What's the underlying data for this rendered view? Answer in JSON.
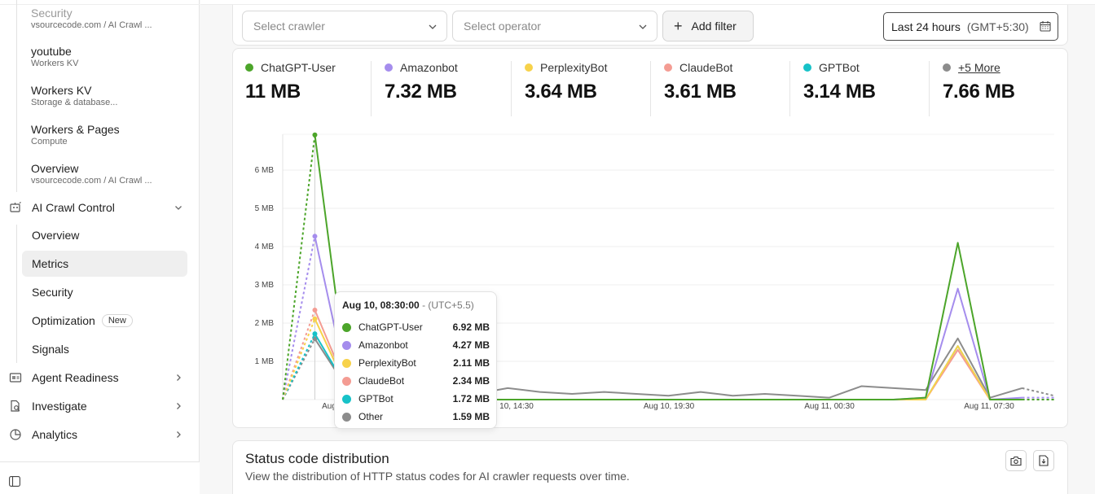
{
  "sidebar": {
    "top_items": [
      {
        "title": "Security",
        "subtitle": "vsourcecode.com  /  AI Crawl ..."
      },
      {
        "title": "youtube",
        "subtitle": "Workers KV"
      },
      {
        "title": "Workers KV",
        "subtitle": "Storage & database..."
      },
      {
        "title": "Workers & Pages",
        "subtitle": "Compute"
      },
      {
        "title": "Overview",
        "subtitle": "vsourcecode.com  /  AI Crawl ..."
      }
    ],
    "ai_crawl_control": {
      "label": "AI Crawl Control",
      "items": [
        {
          "label": "Overview"
        },
        {
          "label": "Metrics"
        },
        {
          "label": "Security"
        },
        {
          "label": "Optimization",
          "badge": "New"
        },
        {
          "label": "Signals"
        }
      ]
    },
    "groups": [
      {
        "label": "Agent Readiness"
      },
      {
        "label": "Investigate"
      },
      {
        "label": "Analytics"
      }
    ]
  },
  "filters": {
    "crawler_placeholder": "Select crawler",
    "operator_placeholder": "Select operator",
    "add_filter_label": "Add filter",
    "date_range": "Last 24 hours",
    "timezone": "(GMT+5:30)"
  },
  "stats": [
    {
      "name": "ChatGPT-User",
      "value": "11 MB",
      "color": "#4ca52a"
    },
    {
      "name": "Amazonbot",
      "value": "7.32 MB",
      "color": "#a58ded"
    },
    {
      "name": "PerplexityBot",
      "value": "3.64 MB",
      "color": "#f7d24a"
    },
    {
      "name": "ClaudeBot",
      "value": "3.61 MB",
      "color": "#f49c93"
    },
    {
      "name": "GPTBot",
      "value": "3.14 MB",
      "color": "#17c2c8"
    },
    {
      "name": "+5 More",
      "value": "7.66 MB",
      "color": "#8c8c8c"
    }
  ],
  "chart_data": {
    "type": "line",
    "y_ticks": [
      "1 MB",
      "2 MB",
      "3 MB",
      "4 MB",
      "5 MB",
      "6 MB"
    ],
    "ylim": [
      0,
      7
    ],
    "x_tick_labels": [
      "Aug",
      "10, 14:30",
      "Aug 10, 19:30",
      "Aug 11, 00:30",
      "Aug 11, 07:30"
    ],
    "x_points": 25,
    "series": [
      {
        "name": "ChatGPT-User",
        "color": "#4ca52a",
        "values": [
          0,
          6.92,
          0.5,
          0,
          0,
          0,
          0,
          0,
          0,
          0,
          0,
          0,
          0,
          0,
          0,
          0,
          0,
          0,
          0,
          0,
          0.05,
          4.1,
          0,
          0,
          0
        ]
      },
      {
        "name": "Amazonbot",
        "color": "#a58ded",
        "values": [
          0,
          4.27,
          0.4,
          0,
          0,
          0,
          0,
          0,
          0,
          0,
          0,
          0,
          0,
          0,
          0,
          0,
          0,
          0,
          0,
          0,
          0.05,
          2.9,
          0,
          0.05,
          0.05
        ]
      },
      {
        "name": "PerplexityBot",
        "color": "#f7d24a",
        "values": [
          0,
          2.11,
          0.3,
          0,
          0,
          0,
          0,
          0,
          0,
          0,
          0,
          0,
          0,
          0,
          0,
          0,
          0,
          0,
          0,
          0,
          0,
          1.4,
          0,
          0,
          0
        ]
      },
      {
        "name": "ClaudeBot",
        "color": "#f49c93",
        "values": [
          0,
          2.34,
          0.35,
          0,
          0,
          0,
          0,
          0,
          0,
          0,
          0,
          0,
          0,
          0,
          0,
          0,
          0,
          0,
          0,
          0,
          0,
          1.3,
          0,
          0,
          0
        ]
      },
      {
        "name": "GPTBot",
        "color": "#17c2c8",
        "values": [
          0,
          1.72,
          0.3,
          0,
          0,
          0,
          0,
          0,
          0,
          0,
          0,
          0,
          0,
          0,
          0,
          0,
          0,
          0,
          0,
          0,
          0,
          1.4,
          0,
          0,
          0
        ]
      },
      {
        "name": "Other",
        "color": "#8c8c8c",
        "values": [
          0,
          1.59,
          0.3,
          0,
          0.35,
          0.05,
          0.15,
          0.3,
          0.2,
          0.15,
          0.2,
          0.15,
          0.1,
          0.2,
          0.1,
          0.15,
          0.1,
          0.05,
          0.35,
          0.3,
          0.25,
          1.6,
          0.05,
          0.3,
          0.1
        ]
      }
    ]
  },
  "tooltip": {
    "time": "Aug 10, 08:30:00",
    "tz": "- (UTC+5.5)",
    "rows": [
      {
        "name": "ChatGPT-User",
        "value": "6.92 MB",
        "color": "#4ca52a"
      },
      {
        "name": "Amazonbot",
        "value": "4.27 MB",
        "color": "#a58ded"
      },
      {
        "name": "PerplexityBot",
        "value": "2.11 MB",
        "color": "#f7d24a"
      },
      {
        "name": "ClaudeBot",
        "value": "2.34 MB",
        "color": "#f49c93"
      },
      {
        "name": "GPTBot",
        "value": "1.72 MB",
        "color": "#17c2c8"
      },
      {
        "name": "Other",
        "value": "1.59 MB",
        "color": "#8c8c8c"
      }
    ]
  },
  "status_section": {
    "title": "Status code distribution",
    "subtitle": "View the distribution of HTTP status codes for AI crawler requests over time."
  }
}
